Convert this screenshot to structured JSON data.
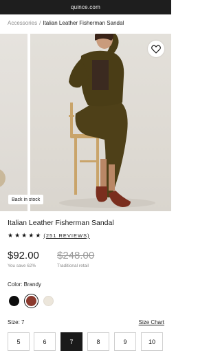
{
  "browser": {
    "url": "quince.com"
  },
  "breadcrumb": {
    "parent": "Accessories",
    "separator": "/",
    "current": "Italian Leather Fisherman Sandal"
  },
  "gallery": {
    "badge": "Back in stock"
  },
  "product": {
    "title": "Italian Leather Fisherman Sandal",
    "rating_stars": 5,
    "reviews": "(251 REVIEWS)",
    "price": "$92.00",
    "savings": "You save 62%",
    "retail_price": "$248.00",
    "retail_label": "Traditional retail"
  },
  "color": {
    "label": "Color: Brandy",
    "swatches": [
      {
        "name": "Black",
        "hex": "#0d0d0d"
      },
      {
        "name": "Brandy",
        "hex": "#8b3a2e",
        "selected": true
      },
      {
        "name": "Cream",
        "hex": "#ece6db"
      }
    ]
  },
  "size": {
    "label": "Size: 7",
    "chart_link": "Size Chart",
    "options": [
      "5",
      "6",
      "7",
      "8",
      "9",
      "10"
    ],
    "selected": "7"
  },
  "colors": {
    "text": "#1a1a1a",
    "muted": "#8a8a8a",
    "selected_bg": "#1a1a1a"
  }
}
